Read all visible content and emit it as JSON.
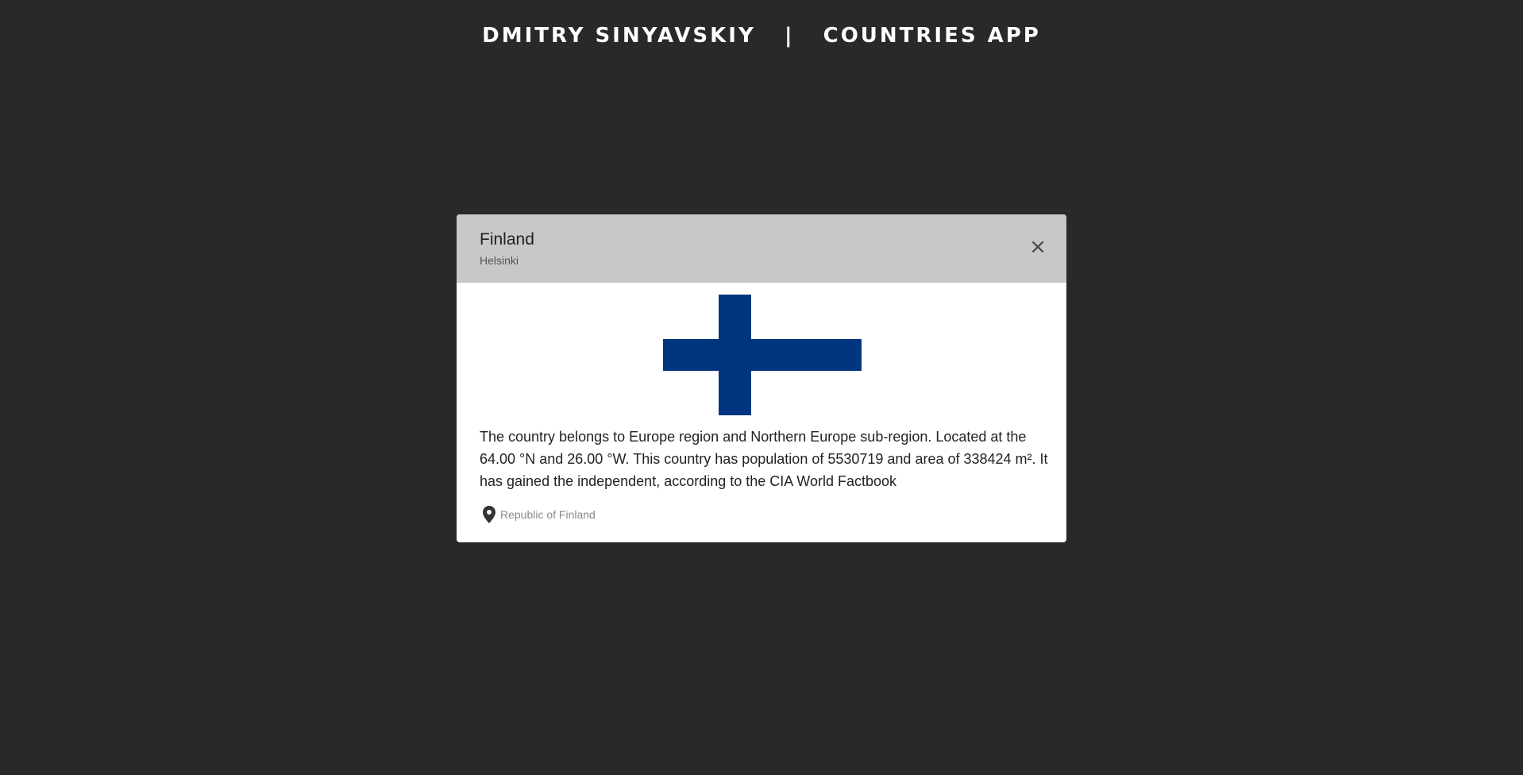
{
  "header": {
    "title": "DMITRY SINYAVSKIY   |   COUNTRIES APP"
  },
  "modal": {
    "country_name": "Finland",
    "capital": "Helsinki",
    "close_label": "×",
    "flag": {
      "background_color": "#ffffff",
      "cross_color": "#003580"
    },
    "description": "The country belongs to Europe region and Northern Europe sub-region. Located at the 64.00 °N and 26.00 °W. This country has population of 5530719 and area of 338424 m². It has gained the independent, according to the CIA World Factbook",
    "official_name": "Republic of Finland",
    "icons": {
      "location": "map-pin-icon",
      "close": "close-icon"
    }
  }
}
